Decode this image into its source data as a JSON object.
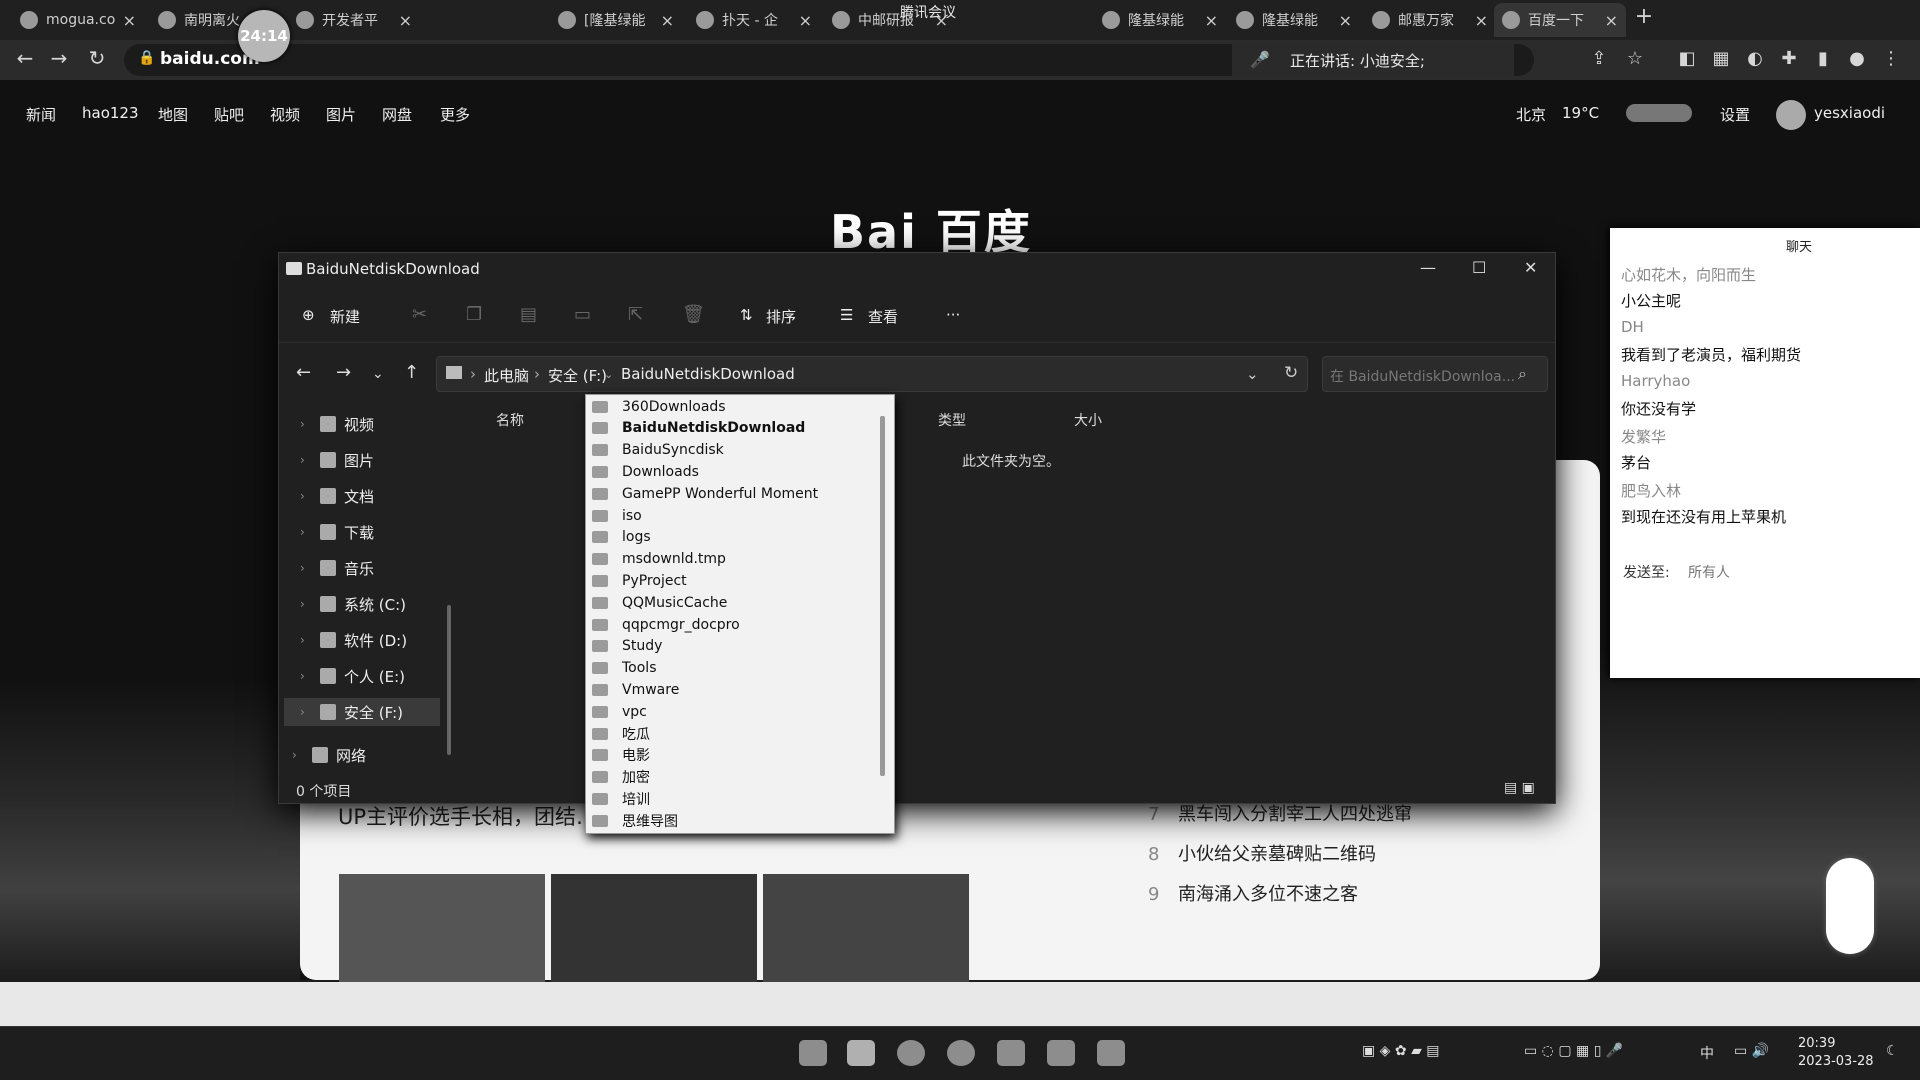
{
  "browser": {
    "tabs": [
      {
        "label": "mogua.co"
      },
      {
        "label": "南明离火"
      },
      {
        "label": "开发者平"
      },
      {
        "label": "[隆基绿能"
      },
      {
        "label": "扑天 - 企"
      },
      {
        "label": "中邮研报"
      },
      {
        "label": "隆基绿能"
      },
      {
        "label": "隆基绿能"
      },
      {
        "label": "邮惠万家"
      },
      {
        "label": "百度一下"
      }
    ],
    "recording_timer": "24:14",
    "meeting_hint": "腾讯会议",
    "url": "baidu.com",
    "speaking_text": "正在讲话: 小迪安全;"
  },
  "baidu": {
    "nav": [
      "新闻",
      "hao123",
      "地图",
      "贴吧",
      "视频",
      "图片",
      "网盘",
      "更多"
    ],
    "city": "北京",
    "temperature": "19°C",
    "settings": "设置",
    "username": "yesxiaodi",
    "logo_text": "Bai 百度",
    "headline": "UP主评价选手长相，团结… 不该惹的人",
    "hot_list": [
      {
        "rank": "7",
        "text": "黑车闯入分割宰工人四处逃窜"
      },
      {
        "rank": "8",
        "text": "小伙给父亲墓碑贴二维码"
      },
      {
        "rank": "9",
        "text": "南海涌入多位不速之客"
      }
    ]
  },
  "chat": {
    "title": "聊天",
    "messages": [
      {
        "user": "心如花木，向阳而生",
        "text": "小公主呢"
      },
      {
        "user": "DH",
        "text": "我看到了老演员，福利期货"
      },
      {
        "user": "Harryhao",
        "text": "你还没有学"
      },
      {
        "user": "发繁华",
        "text": "茅台"
      },
      {
        "user": "肥鸟入林",
        "text": "到现在还没有用上苹果机"
      }
    ],
    "send_to_label": "发送至:",
    "send_to_value": "所有人"
  },
  "explorer": {
    "title": "BaiduNetdiskDownload",
    "commands": {
      "new": "新建",
      "sort": "排序",
      "view": "查看",
      "more": "···"
    },
    "breadcrumb": [
      "此电脑",
      "安全 (F:)",
      "BaiduNetdiskDownload"
    ],
    "search_placeholder": "在 BaiduNetdiskDownloa...",
    "sidebar": [
      {
        "label": "视频"
      },
      {
        "label": "图片"
      },
      {
        "label": "文档"
      },
      {
        "label": "下载"
      },
      {
        "label": "音乐"
      },
      {
        "label": "系统 (C:)"
      },
      {
        "label": "软件 (D:)"
      },
      {
        "label": "个人 (E:)"
      },
      {
        "label": "安全 (F:)",
        "selected": true
      },
      {
        "label": "网络"
      }
    ],
    "columns": [
      "名称",
      "类型",
      "大小"
    ],
    "empty_text": "此文件夹为空。",
    "status": "0 个项目",
    "dropdown": [
      "360Downloads",
      "BaiduNetdiskDownload",
      "BaiduSyncdisk",
      "Downloads",
      "GamePP Wonderful Moment",
      "iso",
      "logs",
      "msdownld.tmp",
      "PyProject",
      "QQMusicCache",
      "qqpcmgr_docpro",
      "Study",
      "Tools",
      "Vmware",
      "vpc",
      "吃瓜",
      "电影",
      "加密",
      "培训",
      "思维导图"
    ],
    "dropdown_selected": "BaiduNetdiskDownload"
  },
  "taskbar": {
    "ime": "中",
    "time": "20:39",
    "date": "2023-03-28"
  }
}
